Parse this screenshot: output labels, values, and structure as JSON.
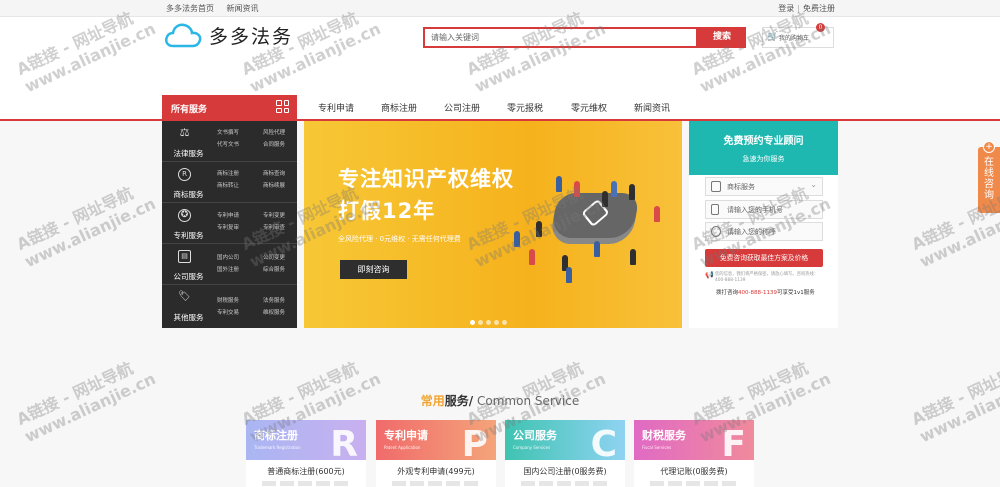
{
  "topbar": {
    "home": "多多法务首页",
    "news": "新闻资讯",
    "login": "登录",
    "separator": "|",
    "register": "免费注册"
  },
  "header": {
    "logo": "多多法务",
    "search_placeholder": "请输入关键词",
    "search_button": "搜索",
    "cart_label": "我的购物车",
    "cart_count": "0"
  },
  "nav": {
    "all_services": "所有服务",
    "items": [
      "专利申请",
      "商标注册",
      "公司注册",
      "零元报税",
      "零元维权",
      "新闻资讯"
    ]
  },
  "sidebar": {
    "categories": [
      {
        "name": "法律服务",
        "icon": "scales-icon",
        "subs": [
          "文书撰写",
          "风险代理",
          "代写文书",
          "合同服务"
        ]
      },
      {
        "name": "商标服务",
        "icon": "registered-icon",
        "subs": [
          "商标注册",
          "商标查询",
          "商标转让",
          "商标续展"
        ]
      },
      {
        "name": "专利服务",
        "icon": "award-icon",
        "subs": [
          "专利申请",
          "专利变更",
          "专利复审",
          "专利审查"
        ]
      },
      {
        "name": "公司服务",
        "icon": "id-card-icon",
        "subs": [
          "国内公司",
          "公司变更",
          "国外注册",
          "综合服务"
        ]
      },
      {
        "name": "其他服务",
        "icon": "tag-icon",
        "subs": [
          "财税服务",
          "法务服务",
          "专利交易",
          "维权服务"
        ]
      }
    ]
  },
  "banner": {
    "headline1": "专注知识产权维权",
    "headline2": "打假12年",
    "subline": "全风险代理  ·  0元维权  ·  无需任何代理费",
    "cta": "即刻咨询",
    "slides": 5,
    "active_slide": 1
  },
  "consult_form": {
    "title": "免费预约专业顾问",
    "subtitle": "急速为你服务",
    "service_select": "商标服务",
    "phone_placeholder": "请输入您的手机号",
    "name_placeholder": "请输入您的称呼",
    "submit": "免费咨询获取最佳方案及价格",
    "note": "您的信息，我们将严格保密，请放心填写。咨询热线：400-888-1139",
    "tel_prefix": "拨打咨询",
    "tel_number": "400-888-1139",
    "tel_suffix": "可享受1v1服务"
  },
  "service_section": {
    "title_highlight": "常用",
    "title_bold": "服务/",
    "title_en": " Common Service",
    "cards": [
      {
        "title": "商标注册",
        "en": "Trademark Registration",
        "letter": "R",
        "price_text": "普通商标注册(600元)",
        "gradient": [
          "#a9b6f2",
          "#c9b0f0"
        ]
      },
      {
        "title": "专利申请",
        "en": "Patent Application",
        "letter": "P",
        "price_text": "外观专利申请(499元)",
        "gradient": [
          "#f06b6b",
          "#f4a47a"
        ]
      },
      {
        "title": "公司服务",
        "en": "Company Services",
        "letter": "C",
        "price_text": "国内公司注册(0服务费)",
        "gradient": [
          "#3fc3b1",
          "#8fd3f2"
        ]
      },
      {
        "title": "财税服务",
        "en": "Fiscal Services",
        "letter": "F",
        "price_text": "代理记账(0服务费)",
        "gradient": [
          "#e06ac4",
          "#f08a9c"
        ]
      }
    ]
  },
  "float_tab": {
    "plus": "+",
    "label": "在线咨询"
  },
  "watermark": {
    "line1": "A链接 - 网址导航",
    "line2": "www.alianjie.cn"
  }
}
